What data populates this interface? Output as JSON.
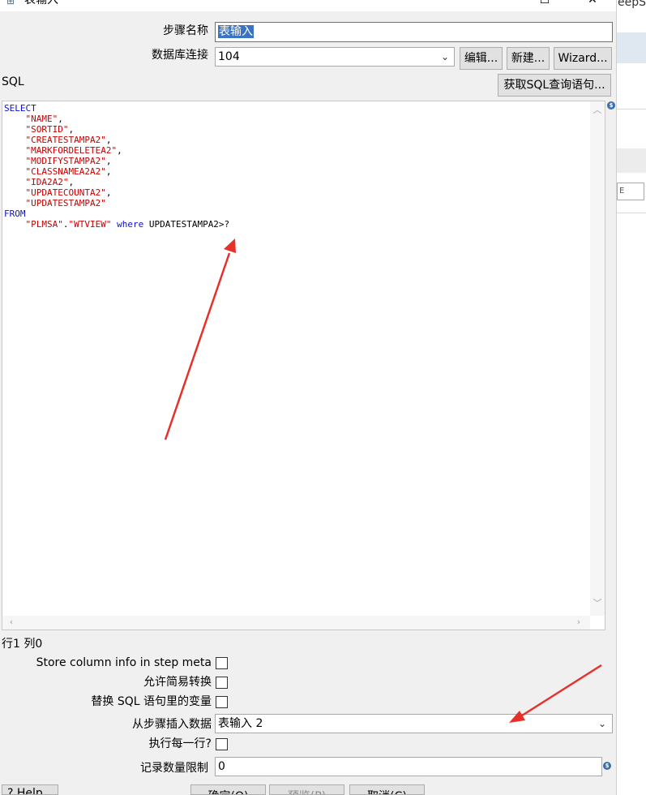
{
  "window": {
    "title": "表输入"
  },
  "background_window": {
    "title_fragment": "eepS",
    "field_fragment": "E"
  },
  "form": {
    "step_name_label": "步骤名称",
    "step_name_value": "表输入",
    "db_connection_label": "数据库连接",
    "db_connection_value": "104",
    "edit_button": "编辑...",
    "new_button": "新建...",
    "wizard_button": "Wizard...",
    "sql_label": "SQL",
    "get_sql_button": "获取SQL查询语句..."
  },
  "sql": {
    "lines": [
      [
        {
          "t": "kw",
          "v": "SELECT"
        }
      ],
      [
        {
          "t": "plain",
          "v": "    "
        },
        {
          "t": "str",
          "v": "\"NAME\""
        },
        {
          "t": "plain",
          "v": ","
        }
      ],
      [
        {
          "t": "plain",
          "v": "    "
        },
        {
          "t": "str",
          "v": "\"SORTID\""
        },
        {
          "t": "plain",
          "v": ","
        }
      ],
      [
        {
          "t": "plain",
          "v": "    "
        },
        {
          "t": "str",
          "v": "\"CREATESTAMPA2\""
        },
        {
          "t": "plain",
          "v": ","
        }
      ],
      [
        {
          "t": "plain",
          "v": "    "
        },
        {
          "t": "str",
          "v": "\"MARKFORDELETEA2\""
        },
        {
          "t": "plain",
          "v": ","
        }
      ],
      [
        {
          "t": "plain",
          "v": "    "
        },
        {
          "t": "str",
          "v": "\"MODIFYSTAMPA2\""
        },
        {
          "t": "plain",
          "v": ","
        }
      ],
      [
        {
          "t": "plain",
          "v": "    "
        },
        {
          "t": "str",
          "v": "\"CLASSNAMEA2A2\""
        },
        {
          "t": "plain",
          "v": ","
        }
      ],
      [
        {
          "t": "plain",
          "v": "    "
        },
        {
          "t": "str",
          "v": "\"IDA2A2\""
        },
        {
          "t": "plain",
          "v": ","
        }
      ],
      [
        {
          "t": "plain",
          "v": "    "
        },
        {
          "t": "str",
          "v": "\"UPDATECOUNTA2\""
        },
        {
          "t": "plain",
          "v": ","
        }
      ],
      [
        {
          "t": "plain",
          "v": "    "
        },
        {
          "t": "str",
          "v": "\"UPDATESTAMPA2\""
        }
      ],
      [
        {
          "t": "kw",
          "v": "FROM"
        }
      ],
      [
        {
          "t": "plain",
          "v": "    "
        },
        {
          "t": "str",
          "v": "\"PLMSA\""
        },
        {
          "t": "plain",
          "v": "."
        },
        {
          "t": "str",
          "v": "\"WTVIEW\""
        },
        {
          "t": "plain",
          "v": " "
        },
        {
          "t": "kw",
          "v": "where"
        },
        {
          "t": "plain",
          "v": " UPDATESTAMPA2>?"
        }
      ]
    ]
  },
  "cursor_position": "行1 列0",
  "options": {
    "store_column_info_label": "Store column info in step meta",
    "lazy_conversion_label": "允许简易转换",
    "replace_variables_label": "替换 SQL 语句里的变量",
    "insert_from_step_label": "从步骤插入数据",
    "insert_from_step_value": "表输入 2",
    "execute_each_row_label": "执行每一行?",
    "limit_label": "记录数量限制",
    "limit_value": "0"
  },
  "footer": {
    "help_button": "Help",
    "ok_button": "确定(O)",
    "preview_button": "预览(P)",
    "cancel_button": "取消(C)"
  },
  "annotations": {
    "arrow_color": "#e8302a"
  }
}
